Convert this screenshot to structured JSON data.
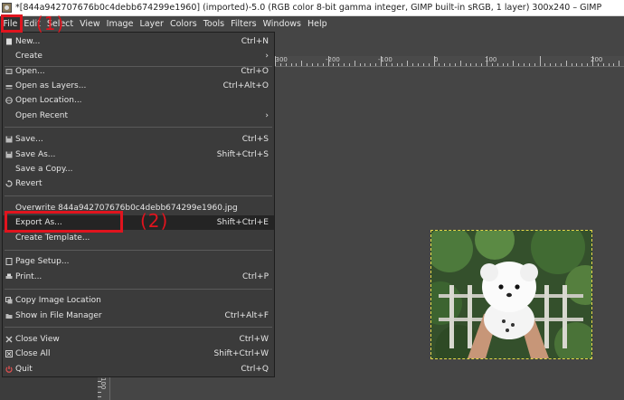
{
  "window": {
    "title": "*[844a942707676b0c4debb674299e1960] (imported)-5.0 (RGB color 8-bit gamma integer, GIMP built-in sRGB, 1 layer) 300x240 – GIMP"
  },
  "menubar": {
    "items": [
      "File",
      "Edit",
      "Select",
      "View",
      "Image",
      "Layer",
      "Colors",
      "Tools",
      "Filters",
      "Windows",
      "Help"
    ]
  },
  "file_menu": {
    "items": [
      {
        "label": "New...",
        "shortcut": "Ctrl+N",
        "icon": "new-icon"
      },
      {
        "label": "Create",
        "shortcut": "",
        "submenu": true
      },
      {
        "label": "Open...",
        "shortcut": "Ctrl+O",
        "icon": "open-icon"
      },
      {
        "label": "Open as Layers...",
        "shortcut": "Ctrl+Alt+O",
        "icon": "open-layers-icon"
      },
      {
        "label": "Open Location...",
        "shortcut": "",
        "icon": "globe-icon"
      },
      {
        "label": "Open Recent",
        "shortcut": "",
        "submenu": true
      },
      {
        "label": "Save...",
        "shortcut": "Ctrl+S",
        "icon": "save-icon"
      },
      {
        "label": "Save As...",
        "shortcut": "Shift+Ctrl+S",
        "icon": "save-as-icon"
      },
      {
        "label": "Save a Copy...",
        "shortcut": ""
      },
      {
        "label": "Revert",
        "shortcut": "",
        "icon": "revert-icon"
      },
      {
        "label": "Overwrite 844a942707676b0c4debb674299e1960.jpg",
        "shortcut": ""
      },
      {
        "label": "Export As...",
        "shortcut": "Shift+Ctrl+E"
      },
      {
        "label": "Create Template...",
        "shortcut": ""
      },
      {
        "label": "Page Setup...",
        "shortcut": "",
        "icon": "page-setup-icon"
      },
      {
        "label": "Print...",
        "shortcut": "Ctrl+P",
        "icon": "print-icon"
      },
      {
        "label": "Copy Image Location",
        "shortcut": "",
        "icon": "copy-icon"
      },
      {
        "label": "Show in File Manager",
        "shortcut": "Ctrl+Alt+F",
        "icon": "folder-icon"
      },
      {
        "label": "Close View",
        "shortcut": "Ctrl+W",
        "icon": "close-icon"
      },
      {
        "label": "Close All",
        "shortcut": "Shift+Ctrl+W",
        "icon": "close-all-icon"
      },
      {
        "label": "Quit",
        "shortcut": "Ctrl+Q",
        "icon": "quit-icon"
      }
    ]
  },
  "ruler": {
    "labels": [
      "-300",
      "-200",
      "-100",
      "0",
      "100",
      "200"
    ],
    "left_label": "100"
  },
  "annotations": {
    "step1": "(1)",
    "step2": "(2)",
    "color": "#e0141e"
  },
  "colors": {
    "menu_bg": "#3b3b3b",
    "highlight": "#242424",
    "canvas_bg": "#454545",
    "selection_border": "#e6d84a"
  }
}
